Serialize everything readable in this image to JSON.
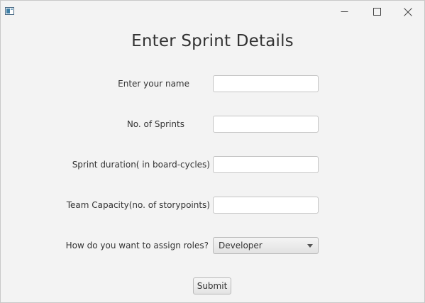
{
  "window": {
    "controls": {
      "minimize_icon": "minimize-icon",
      "maximize_icon": "maximize-icon",
      "close_icon": "close-icon"
    }
  },
  "form": {
    "title": "Enter Sprint Details",
    "fields": [
      {
        "label": "Enter your name",
        "value": "",
        "placeholder": ""
      },
      {
        "label": "No. of Sprints",
        "value": "",
        "placeholder": ""
      },
      {
        "label": "Sprint duration( in board-cycles)",
        "value": "",
        "placeholder": ""
      },
      {
        "label": "Team Capacity(no. of storypoints)",
        "value": "",
        "placeholder": ""
      }
    ],
    "roles": {
      "label": "How do you want to assign roles?",
      "selected": "Developer"
    },
    "submit_label": "Submit"
  },
  "colors": {
    "background": "#f3f3f3",
    "text": "#333333",
    "field_border": "#c4c4c4"
  }
}
